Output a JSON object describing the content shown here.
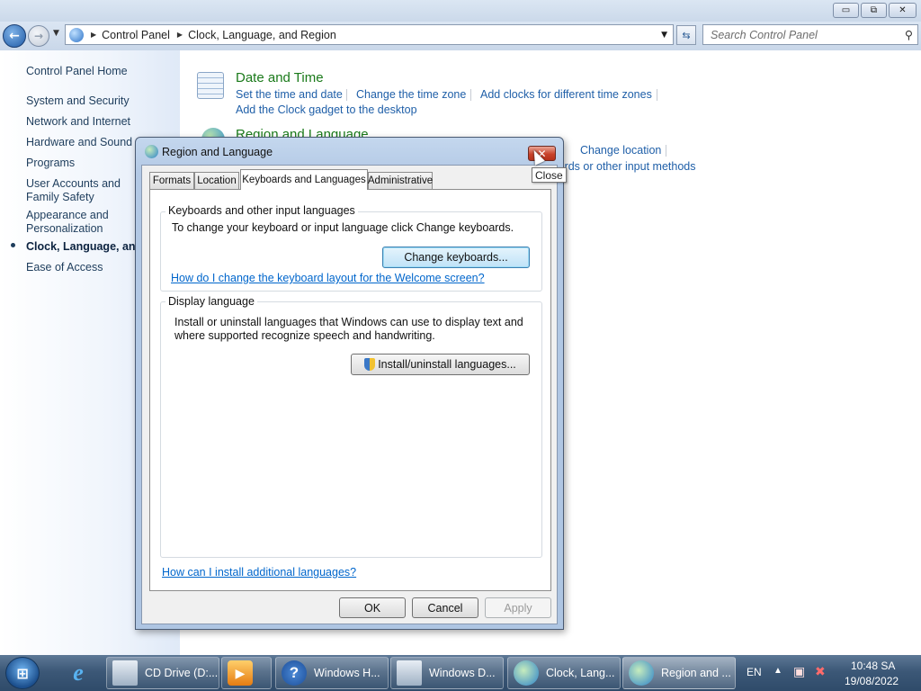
{
  "window": {
    "minimize": "▭",
    "maximize": "⧉",
    "close": "✕"
  },
  "nav": {
    "back": "←",
    "forward": "→",
    "breadcrumb": [
      "Control Panel",
      "Clock, Language, and Region"
    ],
    "search_placeholder": "Search Control Panel"
  },
  "sidebar": {
    "home": "Control Panel Home",
    "items": [
      "System and Security",
      "Network and Internet",
      "Hardware and Sound",
      "Programs",
      "User Accounts and Family Safety",
      "Appearance and Personalization",
      "Clock, Language, and Region",
      "Ease of Access"
    ]
  },
  "content": {
    "date_time": {
      "title": "Date and Time",
      "links": [
        "Set the time and date",
        "Change the time zone",
        "Add clocks for different time zones",
        "Add the Clock gadget to the desktop"
      ]
    },
    "region": {
      "title": "Region and Language",
      "links": [
        "Change location",
        "Change keyboards or other input methods"
      ]
    }
  },
  "dialog": {
    "title": "Region and Language",
    "close_tooltip": "Close",
    "tabs": [
      "Formats",
      "Location",
      "Keyboards and Languages",
      "Administrative"
    ],
    "selected_tab": "Keyboards and Languages",
    "keyboards_group": {
      "label": "Keyboards and other input languages",
      "text": "To change your keyboard or input language click Change keyboards.",
      "button": "Change keyboards...",
      "link": "How do I change the keyboard layout for the Welcome screen?"
    },
    "display_group": {
      "label": "Display language",
      "text_line1": "Install or uninstall languages that Windows can use to display text and",
      "text_line2": "where supported recognize speech and handwriting.",
      "button": "Install/uninstall languages..."
    },
    "bottom_link": "How can I install additional languages?",
    "ok": "OK",
    "cancel": "Cancel",
    "apply": "Apply"
  },
  "taskbar": {
    "items": [
      "CD Drive (D:...",
      "Windows H...",
      "Windows D...",
      "Clock, Lang...",
      "Region and ..."
    ],
    "language": "EN",
    "time": "10:48 SA",
    "date": "19/08/2022"
  }
}
